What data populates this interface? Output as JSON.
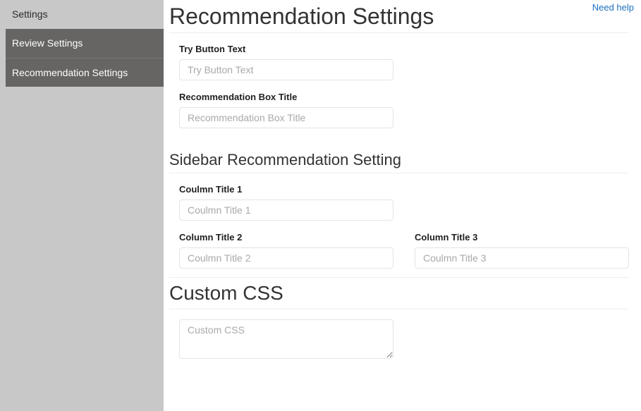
{
  "sidebar": {
    "heading": "Settings",
    "items": [
      {
        "label": "Review Settings"
      },
      {
        "label": "Recommendation Settings"
      }
    ]
  },
  "header": {
    "title": "Recommendation Settings",
    "help_link": "Need help"
  },
  "main": {
    "fields": [
      {
        "label": "Try Button Text",
        "value": "",
        "placeholder": "Try Button Text"
      },
      {
        "label": "Recommendation Box Title",
        "value": "",
        "placeholder": "Recommendation Box Title"
      }
    ],
    "sidebar_section": {
      "title": "Sidebar Recommendation Setting",
      "column_one": {
        "label": "Coulmn Title 1",
        "value": "",
        "placeholder": "Coulmn Title 1"
      },
      "column_two": {
        "label": "Column Title 2",
        "value": "",
        "placeholder": "Coulmn Title 2"
      },
      "column_three": {
        "label": "Column Title 3",
        "value": "",
        "placeholder": "Coulmn Title 3"
      }
    },
    "custom_css": {
      "title": "Custom CSS",
      "value": "",
      "placeholder": "Custom CSS"
    }
  },
  "colors": {
    "sidebar_bg": "#c8c8c8",
    "sidebar_item_bg": "#666564",
    "sidebar_item_text": "#ffffff",
    "link": "#1e70bf",
    "heading": "#333333",
    "input_border": "#e2e4e6",
    "placeholder": "#a9a9a9",
    "divider": "#eceded"
  }
}
